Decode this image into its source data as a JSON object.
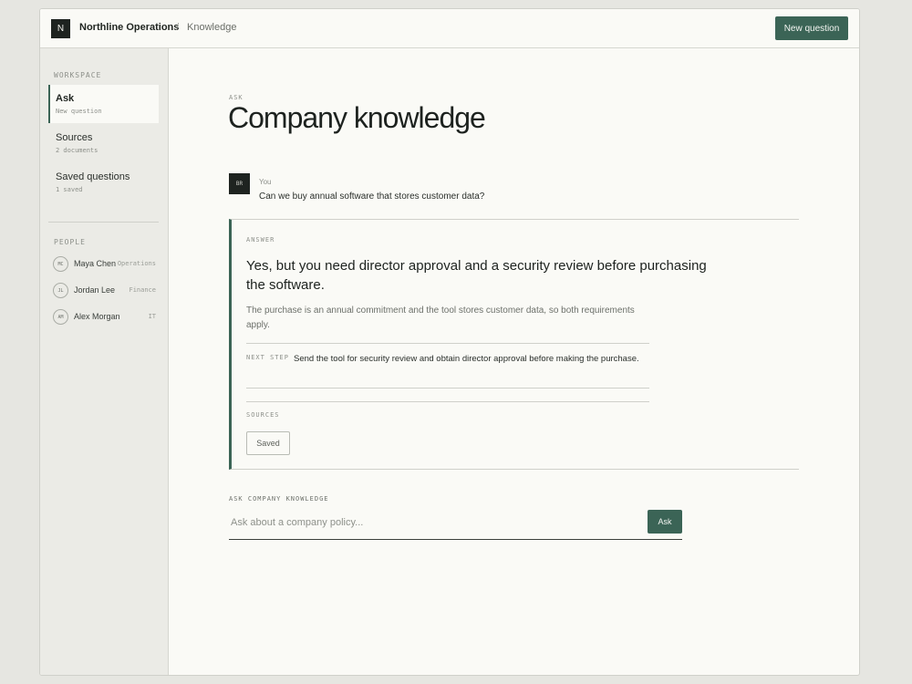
{
  "topbar": {
    "logo_letter": "N",
    "org_name": "Northline Operations",
    "separator": "/",
    "breadcrumb": "Knowledge",
    "new_question_label": "New question"
  },
  "sidebar": {
    "workspace_heading": "WORKSPACE",
    "nav": [
      {
        "label": "Ask",
        "sub": "New question",
        "active": true
      },
      {
        "label": "Sources",
        "sub": "2 documents",
        "active": false
      },
      {
        "label": "Saved questions",
        "sub": "1 saved",
        "active": false
      }
    ],
    "people_heading": "PEOPLE",
    "people": [
      {
        "initials": "MC",
        "name": "Maya Chen",
        "dept": "Operations"
      },
      {
        "initials": "JL",
        "name": "Jordan Lee",
        "dept": "Finance"
      },
      {
        "initials": "AM",
        "name": "Alex Morgan",
        "dept": "IT"
      }
    ]
  },
  "main": {
    "kicker": "ASK",
    "title": "Company knowledge",
    "question": {
      "initials": "BR",
      "author": "You",
      "text": "Can we buy annual software that stores customer data?"
    },
    "answer": {
      "label": "ANSWER",
      "headline": "Yes, but you need director approval and a security review before purchasing the software.",
      "body": "The purchase is an annual commitment and the tool stores customer data, so both requirements apply.",
      "next_step_label": "NEXT STEP",
      "next_step_text": "Send the tool for security review and obtain director approval before making the purchase.",
      "sources_label": "SOURCES",
      "saved_label": "Saved"
    },
    "ask": {
      "label": "ASK COMPANY KNOWLEDGE",
      "placeholder": "Ask about a company policy...",
      "value": "",
      "button_label": "Ask"
    }
  },
  "colors": {
    "accent": "#3b6456",
    "page_background": "#fafaf6",
    "sidebar_background": "#ebebe6",
    "dark": "#1e2320"
  }
}
